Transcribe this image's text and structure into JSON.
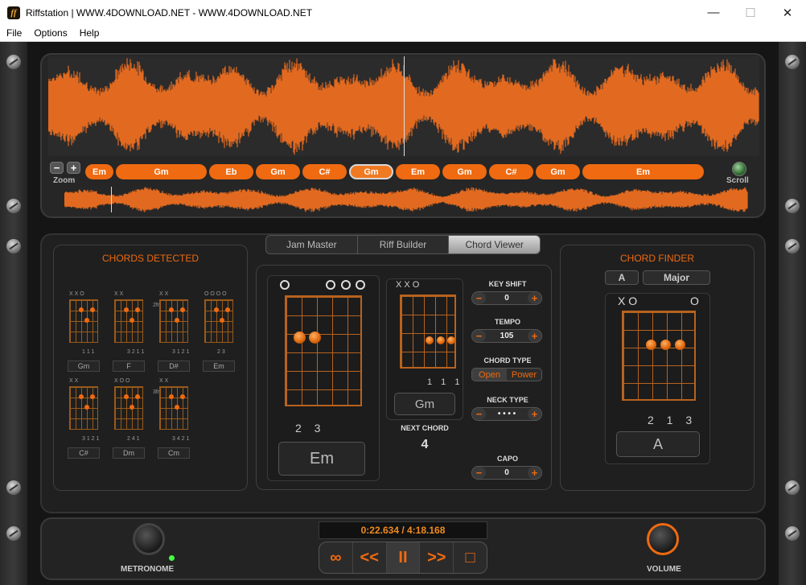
{
  "window": {
    "title": "Riffstation | WWW.4DOWNLOAD.NET - WWW.4DOWNLOAD.NET",
    "app_icon_letter": "ff",
    "minimize": "—",
    "maximize": "☐",
    "close": "✕"
  },
  "menu": [
    "File",
    "Options",
    "Help"
  ],
  "top": {
    "zoom_label": "Zoom",
    "zoom_minus": "−",
    "zoom_plus": "+",
    "scroll_label": "Scroll",
    "chords": [
      {
        "name": "Em",
        "active": false
      },
      {
        "name": "Gm",
        "active": false
      },
      {
        "name": "Eb",
        "active": false
      },
      {
        "name": "Gm",
        "active": false
      },
      {
        "name": "C#",
        "active": false
      },
      {
        "name": "Gm",
        "active": true
      },
      {
        "name": "Em",
        "active": false
      },
      {
        "name": "Gm",
        "active": false
      },
      {
        "name": "C#",
        "active": false
      },
      {
        "name": "Gm",
        "active": false
      },
      {
        "name": "Em",
        "active": false
      }
    ],
    "playhead_fraction": 0.5,
    "mini_playhead_fraction": 0.07
  },
  "tabs": [
    {
      "label": "Jam Master",
      "active": false
    },
    {
      "label": "Riff Builder",
      "active": false
    },
    {
      "label": "Chord Viewer",
      "active": true
    }
  ],
  "detected": {
    "title": "CHORDS DETECTED",
    "chords": [
      {
        "name": "Gm",
        "top": "X X O",
        "fingers": "1 1 1"
      },
      {
        "name": "F",
        "top": "X X",
        "fingers": "3 2 1 1"
      },
      {
        "name": "D#",
        "top": "X X",
        "fingers": "3 1 2 1",
        "fret": "2fr"
      },
      {
        "name": "Em",
        "top": "O     O O O",
        "fingers": "2 3"
      },
      {
        "name": "C#",
        "top": "X X",
        "fingers": "3 1 2 1"
      },
      {
        "name": "Dm",
        "top": "X O O",
        "fingers": "2 4 1"
      },
      {
        "name": "Cm",
        "top": "X X",
        "fingers": "3 4 2 1",
        "fret": "3fr"
      }
    ]
  },
  "viewer": {
    "current": {
      "name": "Em",
      "fingers": "2 3"
    },
    "next": {
      "name": "Gm",
      "top": "X X O",
      "fingers": "1 1 1",
      "label": "NEXT CHORD",
      "count": "4"
    }
  },
  "controls": {
    "key_shift": {
      "label": "KEY SHIFT",
      "value": "0"
    },
    "tempo": {
      "label": "TEMPO",
      "value": "105"
    },
    "chord_type": {
      "label": "CHORD TYPE",
      "options": [
        "Open",
        "Power"
      ],
      "selected": "Open"
    },
    "neck_type": {
      "label": "NECK TYPE",
      "value": "• • • •"
    },
    "capo": {
      "label": "CAPO",
      "value": "0"
    },
    "minus": "−",
    "plus": "+"
  },
  "finder": {
    "title": "CHORD FINDER",
    "root": "A",
    "quality": "Major",
    "top": "X O",
    "top_right": "O",
    "fingers": "2 1 3",
    "name": "A"
  },
  "bottom": {
    "metronome_label": "METRONOME",
    "volume_label": "VOLUME",
    "time": "0:22.634 / 4:18.168",
    "transport": [
      "∞",
      "<<",
      "II",
      ">>",
      "□"
    ],
    "transport_active": 2
  },
  "colors": {
    "accent": "#ef6a10",
    "wave": "#e26a20"
  }
}
